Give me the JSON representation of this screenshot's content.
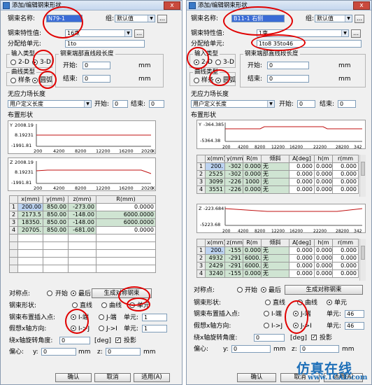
{
  "dialog": {
    "title": "添加/编辑钢束形状",
    "close": "x",
    "labels": {
      "tendon_name": "钢束名称:",
      "group": "组:",
      "tendon_property": "钢束特性值:",
      "assign_element": "分配给单元:",
      "input_type": "输入类型",
      "end_straight": "钢束端部直线段长度",
      "start": "开始:",
      "end": "结束:",
      "mm": "mm",
      "curve_type": "曲线类型",
      "spline": "样条",
      "arc": "圆弧",
      "stress_free_length": "无应力场长度",
      "start2": "开始:",
      "end2": "结束:",
      "layout_shape": "布置形状",
      "symmetry": "对称点:",
      "sym_start": "开始",
      "sym_last": "最后",
      "gen_sym_btn": "生成对称钢束",
      "tendon_shape": "钢束形状:",
      "straight": "直线",
      "curve": "曲线",
      "element": "单元",
      "insert_point": "钢束布置插入点:",
      "i_end": "I-端",
      "j_end": "J-端",
      "unit_label": "单元:",
      "x_axis_dir": "假想x轴方向:",
      "ij": "I->J",
      "ji": "J->I",
      "rot_angle": "绕x轴旋转角度:",
      "deg": "[deg]",
      "projection": "投影",
      "offset": "偏心:",
      "y": "y:",
      "z": "z:",
      "ok": "确认",
      "cancel": "取消",
      "apply": "适用(A)",
      "more": "...",
      "dd": "▼"
    },
    "options": {
      "two_d": "2-D",
      "three_d": "3-D",
      "user_defined_length": "用户定义长度",
      "default_group": "默认值"
    }
  },
  "left": {
    "tendon_name": "N79-1",
    "property": "16束",
    "assign": "1to",
    "input_type": "3-D",
    "curve_type": "圆弧",
    "start_val": "0",
    "end_val": "0",
    "stress_start": "0",
    "stress_end": "0",
    "unit1": "1",
    "unit2": "1",
    "rot_val": "0",
    "offset_y": "0",
    "offset_z": "0",
    "plot_y": {
      "label": "Y",
      "ticks_y": [
        "2008.19",
        "8.19231",
        "-1991.81"
      ],
      "ticks_x": [
        "200",
        "4200",
        "8200",
        "12200",
        "16200",
        "2020"
      ],
      "xlabel": "X"
    },
    "plot_z": {
      "label": "Z",
      "ticks_y": [
        "2008.19",
        "8.19231",
        "-1991.81"
      ],
      "ticks_x": [
        "200",
        "4200",
        "8200",
        "12200",
        "16200",
        "2020"
      ],
      "xlabel": "X"
    },
    "table": {
      "headers": [
        "x(mm)",
        "y(mm)",
        "z(mm)",
        "R(mm)"
      ],
      "rows": [
        [
          "1",
          "200.00",
          "850.00",
          "-273.00",
          "0.0000"
        ],
        [
          "2",
          "2173.5",
          "850.00",
          "-148.00",
          "6000.0000"
        ],
        [
          "3",
          "18350.",
          "850.00",
          "-148.00",
          "6000.0000"
        ],
        [
          "4",
          "20705.",
          "850.00",
          "-681.00",
          "0.0000"
        ]
      ]
    }
  },
  "right": {
    "tendon_name": "B11-1 右侧",
    "property": "1束",
    "assign": "1to8 35to46",
    "input_type": "2-D",
    "curve_type": "圆弧",
    "start_val": "0",
    "end_val": "0",
    "stress_start": "0",
    "stress_end": "0",
    "unit1": "46",
    "unit2": "46",
    "rot_val": "0",
    "offset_y": "0",
    "offset_z": "0",
    "plot_y": {
      "label": "Y",
      "ticks_y": [
        "-364.385",
        "-5364.38"
      ],
      "ticks_x": [
        "200",
        "4200",
        "8200",
        "12200",
        "16200",
        "22200",
        "28200",
        "342"
      ],
      "xlabel": "X"
    },
    "table_y": {
      "headers": [
        "x(mm)",
        "y(mm)",
        "R(m",
        "倾斜",
        "A[deg]",
        "h(m",
        "r(mm"
      ],
      "rows": [
        [
          "1",
          "200.",
          "-302",
          "0.000",
          "无",
          "0.000",
          "0.000",
          "0.000"
        ],
        [
          "2",
          "2525",
          "-302",
          "0.000",
          "无",
          "0.000",
          "0.000",
          "0.000"
        ],
        [
          "3",
          "3099",
          "-226",
          "1000",
          "无",
          "0.000",
          "0.000",
          "0.000"
        ],
        [
          "4",
          "3551",
          "-226",
          "0.000",
          "无",
          "0.000",
          "0.000",
          "0.000"
        ]
      ]
    },
    "plot_z": {
      "label": "Z",
      "ticks_y": [
        "-223.684",
        "-5223.68"
      ],
      "ticks_x": [
        "200",
        "4200",
        "8200",
        "12200",
        "16200",
        "22200",
        "28200",
        "342"
      ],
      "xlabel": "X"
    },
    "table_z": {
      "headers": [
        "x(mm)",
        "z(mm)",
        "R(m",
        "倾斜",
        "A[deg]",
        "h(m",
        "r(mm"
      ],
      "rows": [
        [
          "1",
          "200.",
          "-155",
          "0.000",
          "无",
          "0.000",
          "0.000",
          "0.000"
        ],
        [
          "2",
          "4932",
          "-291",
          "6000.",
          "无",
          "0.000",
          "0.000",
          "0.000"
        ],
        [
          "3",
          "2429",
          "-291",
          "6000.",
          "无",
          "0.000",
          "0.000",
          "0.000"
        ],
        [
          "4",
          "3240",
          "-155",
          "0.000",
          "无",
          "0.000",
          "0.000",
          "0.000"
        ]
      ]
    }
  },
  "watermark": {
    "cn": "仿真在线",
    "url": "www.1CAE.com"
  },
  "colors": {
    "annotation": "#e00000",
    "selection": "#3a6bd6",
    "cell_green": "#cfe4d2",
    "cell_blue": "#bcd3f1"
  }
}
